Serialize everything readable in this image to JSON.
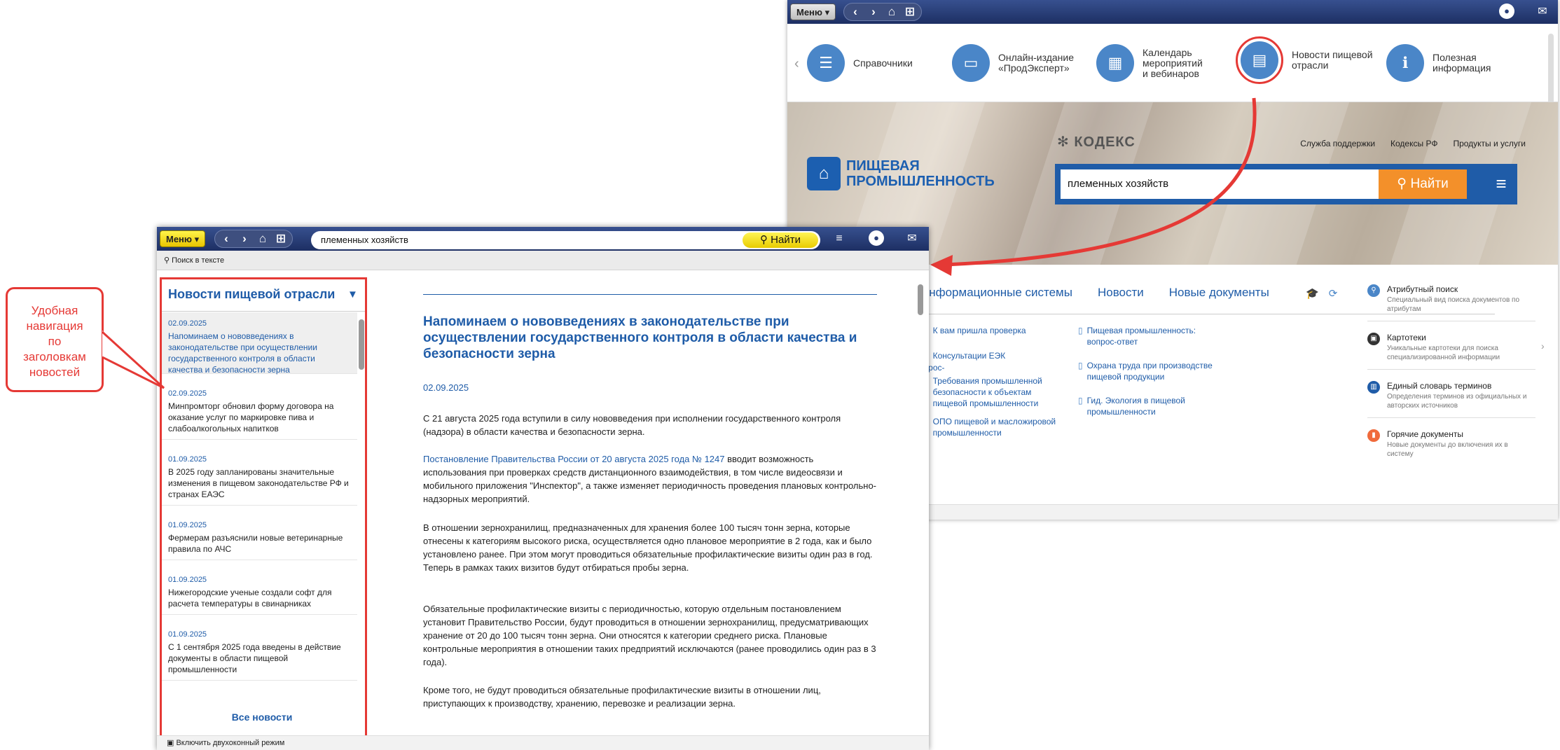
{
  "back_window": {
    "menu_label": "Меню",
    "tiles": [
      {
        "label": "Справочники",
        "icon": "list-icon"
      },
      {
        "label": "Онлайн-издание\n«ПродЭксперт»",
        "icon": "screen-icon"
      },
      {
        "label": "Календарь\nмероприятий\nи вебинаров",
        "icon": "calendar-icon"
      },
      {
        "label": "Новости пищевой\nотрасли",
        "icon": "newspaper-icon"
      },
      {
        "label": "Полезная\nинформация",
        "icon": "info-icon"
      }
    ],
    "brand_name": "ПИЩЕВАЯ\nПРОМЫШЛЕННОСТЬ",
    "kodeks_logo": "КОДЕКС",
    "top_links": [
      "Служба поддержки",
      "Кодексы РФ",
      "Продукты и услуги"
    ],
    "search_value": "племенных хозяйств",
    "search_button": "Найти",
    "tabs": [
      "Информационные системы",
      "Новости",
      "Новые документы"
    ],
    "doc_links_col1": [
      "К вам пришла проверка",
      "Консультации ЕЭК",
      "Требования промышленной безопасности к объектам пищевой промышленности",
      "ОПО пищевой и масложировой промышленности"
    ],
    "doc_links_col2": [
      "Пищевая промышленность: вопрос-ответ",
      "Охрана труда при производстве пищевой продукции",
      "Гид. Экология в пищевой промышленности"
    ],
    "left_fragments": [
      "опрос-",
      "ой"
    ],
    "right_panel": [
      {
        "title": "Атрибутный поиск",
        "desc": "Специальный вид поиска документов по атрибутам"
      },
      {
        "title": "Картотеки",
        "desc": "Уникальные картотеки для поиска специализированной информации"
      },
      {
        "title": "Единый словарь терминов",
        "desc": "Определения терминов из официальных и авторских источников"
      },
      {
        "title": "Горячие документы",
        "desc": "Новые документы до включения их в систему"
      }
    ]
  },
  "front_window": {
    "menu_label": "Меню",
    "search_value": "племенных хозяйств",
    "find_button": "Найти",
    "search_in_text": "Поиск в тексте",
    "sidebar_title": "Новости пищевой отрасли",
    "news": [
      {
        "date": "02.09.2025",
        "title": "Напоминаем о нововведениях в законодательстве при осуществлении государственного контроля в области качества и безопасности зерна",
        "active": true
      },
      {
        "date": "02.09.2025",
        "title": "Минпромторг обновил форму договора на оказание услуг по маркировке пива и слабоалкогольных напитков",
        "active": false
      },
      {
        "date": "01.09.2025",
        "title": "В 2025 году запланированы значительные изменения в пищевом законодательстве РФ и странах ЕАЭС",
        "active": false
      },
      {
        "date": "01.09.2025",
        "title": "Фермерам разъяснили новые ветеринарные правила по АЧС",
        "active": false
      },
      {
        "date": "01.09.2025",
        "title": "Нижегородские ученые создали софт для расчета температуры в свинарниках",
        "active": false
      },
      {
        "date": "01.09.2025",
        "title": "С 1 сентября 2025 года введены в действие документы в области пищевой промышленности",
        "active": false
      }
    ],
    "all_news": "Все новости",
    "article": {
      "title": "Напоминаем о нововведениях в законодательстве при осуществлении государственного контроля в области качества и безопасности зерна",
      "date": "02.09.2025",
      "p1": "С 21 августа 2025 года вступили в силу нововведения при исполнении государственного контроля (надзора) в области качества и безопасности зерна.",
      "p2_link": "Постановление Правительства России от 20 августа 2025 года № 1247",
      "p2_rest": " вводит возможность использования при проверках средств дистанционного взаимодействия, в том числе видеосвязи и мобильного приложения \"Инспектор\", а также изменяет периодичность проведения плановых контрольно-надзорных мероприятий.",
      "p3": "В отношении зернохранилищ, предназначенных для хранения более 100 тысяч тонн зерна, которые отнесены к категориям высокого риска, осуществляется одно плановое мероприятие в 2 года, как и было установлено ранее. При этом могут проводиться обязательные профилактические визиты один раз в год. Теперь в рамках таких визитов будут отбираться пробы зерна.",
      "p4": "Обязательные профилактические визиты с периодичностью, которую отдельным постановлением установит Правительство России, будут проводиться в отношении зернохранилищ, предусматривающих хранение от 20 до 100 тысяч тонн зерна. Они относятся к категории среднего риска. Плановые контрольные мероприятия в отношении таких предприятий исключаются (ранее проводились один раз в 3 года).",
      "p5": "Кроме того, не будут проводиться обязательные профилактические визиты в отношении лиц, приступающих к производству, хранению, перевозке и реализации зерна."
    },
    "status_toggle": "Включить двухоконный режим"
  },
  "callout": "Удобная\nнавигация\nпо\nзаголовкам\nновостей",
  "colors": {
    "accent": "#1f5ca8",
    "highlight": "#e53935",
    "find": "#f3902a"
  }
}
